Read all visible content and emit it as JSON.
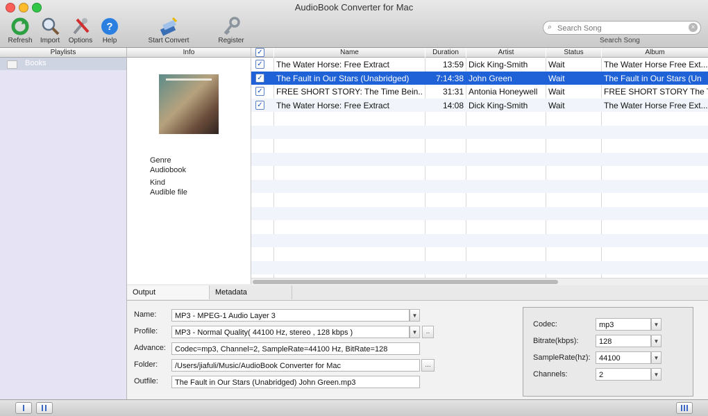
{
  "window": {
    "title": "AudioBook Converter for Mac"
  },
  "toolbar": {
    "refresh": "Refresh",
    "import": "Import",
    "options": "Options",
    "help": "Help",
    "start_convert": "Start Convert",
    "register": "Register"
  },
  "search": {
    "placeholder": "Search Song",
    "caption": "Search Song"
  },
  "sidebar": {
    "header": "Playlists",
    "items": [
      {
        "label": "Books"
      }
    ]
  },
  "info": {
    "header": "Info",
    "genre_label": "Genre",
    "genre_value": "Audiobook",
    "kind_label": "Kind",
    "kind_value": "Audible file"
  },
  "table": {
    "columns": {
      "name": "Name",
      "duration": "Duration",
      "artist": "Artist",
      "status": "Status",
      "album": "Album"
    },
    "rows": [
      {
        "checked": true,
        "name": "The Water Horse: Free Extract",
        "duration": "13:59",
        "artist": "Dick King-Smith",
        "status": "Wait",
        "album": "The Water Horse Free Ext..."
      },
      {
        "checked": true,
        "name": "The Fault in Our Stars (Unabridged)",
        "duration": "7:14:38",
        "artist": "John Green",
        "status": "Wait",
        "album": "The Fault in Our Stars (Un",
        "selected": true
      },
      {
        "checked": true,
        "name": "FREE SHORT STORY: The Time Bein...",
        "duration": "31:31",
        "artist": "Antonia Honeywell",
        "status": "Wait",
        "album": "FREE SHORT STORY The T"
      },
      {
        "checked": true,
        "name": "The Water Horse: Free Extract",
        "duration": "14:08",
        "artist": "Dick King-Smith",
        "status": "Wait",
        "album": "The Water Horse Free Ext..."
      }
    ]
  },
  "tabs": {
    "output": "Output",
    "metadata": "Metadata"
  },
  "output": {
    "name_label": "Name:",
    "name_value": "MP3 - MPEG-1 Audio Layer 3",
    "profile_label": "Profile:",
    "profile_value": "MP3 - Normal Quality( 44100 Hz, stereo , 128 kbps )",
    "advance_label": "Advance:",
    "advance_value": "Codec=mp3, Channel=2, SampleRate=44100 Hz, BitRate=128",
    "folder_label": "Folder:",
    "folder_value": "/Users/jiafuli/Music/AudioBook Converter for Mac",
    "browse": "...",
    "profile_extra": "..",
    "outfile_label": "Outfile:",
    "outfile_value": "The Fault in Our Stars (Unabridged) John Green.mp3"
  },
  "codec": {
    "codec_label": "Codec:",
    "codec_value": "mp3",
    "bitrate_label": "Bitrate(kbps):",
    "bitrate_value": "128",
    "samplerate_label": "SampleRate(hz):",
    "samplerate_value": "44100",
    "channels_label": "Channels:",
    "channels_value": "2"
  },
  "icons": {
    "dropdown": "▼",
    "check": "✓",
    "search": "⌕",
    "clear": "×"
  },
  "colors": {
    "selection": "#1f62d7",
    "help_blue": "#2b7fe0",
    "refresh_green": "#2ea043"
  }
}
